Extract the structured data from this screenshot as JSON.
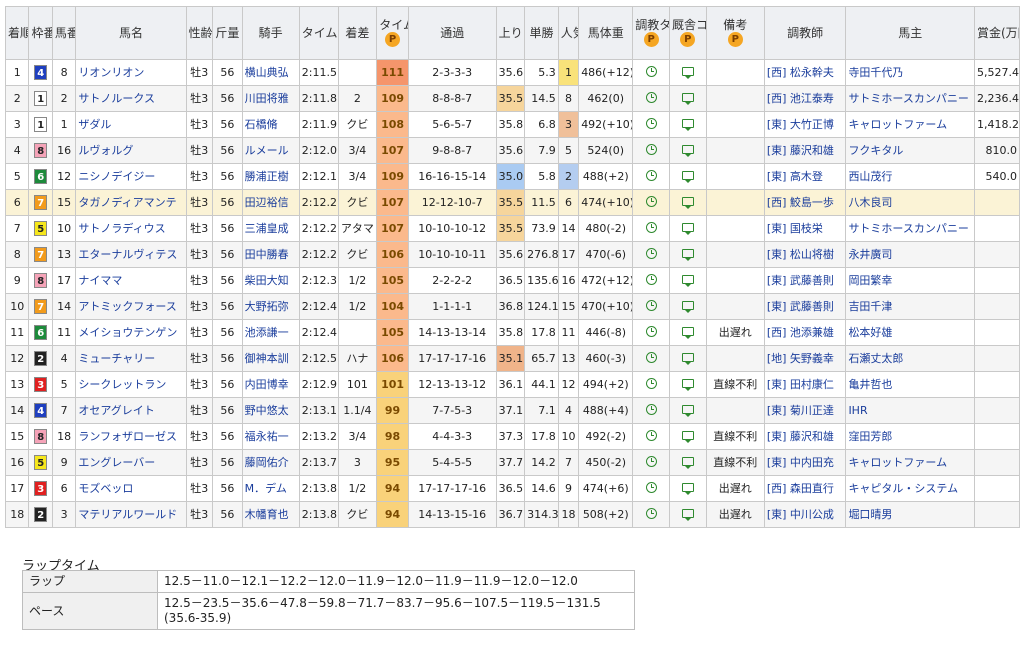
{
  "headers": {
    "rank": "着順",
    "waku": "枠番",
    "num": "馬番",
    "horse": "馬名",
    "sexage": "性齢",
    "weight": "斤量",
    "jockey": "騎手",
    "time": "タイム",
    "margin": "着差",
    "index": "タイム指数",
    "passing": "通過",
    "last3f": "上り",
    "odds": "単勝",
    "pop": "人気",
    "body": "馬体重",
    "train_time": "調教タイム",
    "stable_comment": "厩舎コメント",
    "notes": "備考",
    "trainer": "調教師",
    "owner": "馬主",
    "prize": "賞金(万円)",
    "p_label": "P"
  },
  "colors": {
    "waku": {
      "1": "#ffffff",
      "2": "#222222",
      "3": "#e02020",
      "4": "#1f3fbf",
      "5": "#f6e71c",
      "6": "#1d8a3b",
      "7": "#f29b1c",
      "8": "#f5a3b8"
    },
    "index_high": "#f5956b",
    "index_mid": "#fbb98c",
    "index_low": "#f9d27a",
    "last3f_1": "#aacbf2",
    "last3f_2": "#f0b48a",
    "last3f_3": "#f6d59c",
    "pop_1": "#f9e27a",
    "pop_2": "#b4cdf0",
    "pop_3": "#f0c09a"
  },
  "rows": [
    {
      "rank": "1",
      "waku": "4",
      "num": "8",
      "horse": "リオンリオン",
      "sexage": "牡3",
      "weight": "56",
      "jockey": "横山典弘",
      "time": "2:11.5",
      "margin": "",
      "index": "111",
      "passing": "2-3-3-3",
      "last3f": "35.6",
      "odds": "5.3",
      "pop": "1",
      "body": "486(+12)",
      "notes": "",
      "trainer": "[西] 松永幹夫",
      "owner": "寺田千代乃",
      "prize": "5,527.4"
    },
    {
      "rank": "2",
      "waku": "1",
      "num": "2",
      "horse": "サトノルークス",
      "sexage": "牡3",
      "weight": "56",
      "jockey": "川田将雅",
      "time": "2:11.8",
      "margin": "2",
      "index": "109",
      "passing": "8-8-8-7",
      "last3f": "35.5",
      "odds": "14.5",
      "pop": "8",
      "body": "462(0)",
      "notes": "",
      "trainer": "[西] 池江泰寿",
      "owner": "サトミホースカンパニー",
      "prize": "2,236.4"
    },
    {
      "rank": "3",
      "waku": "1",
      "num": "1",
      "horse": "ザダル",
      "sexage": "牡3",
      "weight": "56",
      "jockey": "石橋脩",
      "time": "2:11.9",
      "margin": "クビ",
      "index": "108",
      "passing": "5-6-5-7",
      "last3f": "35.8",
      "odds": "6.8",
      "pop": "3",
      "body": "492(+10)",
      "notes": "",
      "trainer": "[東] 大竹正博",
      "owner": "キャロットファーム",
      "prize": "1,418.2"
    },
    {
      "rank": "4",
      "waku": "8",
      "num": "16",
      "horse": "ルヴォルグ",
      "sexage": "牡3",
      "weight": "56",
      "jockey": "ルメール",
      "time": "2:12.0",
      "margin": "3/4",
      "index": "107",
      "passing": "9-8-8-7",
      "last3f": "35.6",
      "odds": "7.9",
      "pop": "5",
      "body": "524(0)",
      "notes": "",
      "trainer": "[東] 藤沢和雄",
      "owner": "フクキタル",
      "prize": "810.0"
    },
    {
      "rank": "5",
      "waku": "6",
      "num": "12",
      "horse": "ニシノデイジー",
      "sexage": "牡3",
      "weight": "56",
      "jockey": "勝浦正樹",
      "time": "2:12.1",
      "margin": "3/4",
      "index": "109",
      "passing": "16-16-15-14",
      "last3f": "35.0",
      "odds": "5.8",
      "pop": "2",
      "body": "488(+2)",
      "notes": "",
      "trainer": "[東] 高木登",
      "owner": "西山茂行",
      "prize": "540.0"
    },
    {
      "rank": "6",
      "waku": "7",
      "num": "15",
      "horse": "タガノディアマンテ",
      "sexage": "牡3",
      "weight": "56",
      "jockey": "田辺裕信",
      "time": "2:12.2",
      "margin": "クビ",
      "index": "107",
      "passing": "12-12-10-7",
      "last3f": "35.5",
      "odds": "11.5",
      "pop": "6",
      "body": "474(+10)",
      "notes": "",
      "trainer": "[西] 鮫島一歩",
      "owner": "八木良司",
      "prize": ""
    },
    {
      "rank": "7",
      "waku": "5",
      "num": "10",
      "horse": "サトノラディウス",
      "sexage": "牡3",
      "weight": "56",
      "jockey": "三浦皇成",
      "time": "2:12.2",
      "margin": "アタマ",
      "index": "107",
      "passing": "10-10-10-12",
      "last3f": "35.5",
      "odds": "73.9",
      "pop": "14",
      "body": "480(-2)",
      "notes": "",
      "trainer": "[東] 国枝栄",
      "owner": "サトミホースカンパニー",
      "prize": ""
    },
    {
      "rank": "8",
      "waku": "7",
      "num": "13",
      "horse": "エターナルヴィテス",
      "sexage": "牡3",
      "weight": "56",
      "jockey": "田中勝春",
      "time": "2:12.2",
      "margin": "クビ",
      "index": "106",
      "passing": "10-10-10-11",
      "last3f": "35.6",
      "odds": "276.8",
      "pop": "17",
      "body": "470(-6)",
      "notes": "",
      "trainer": "[東] 松山将樹",
      "owner": "永井廣司",
      "prize": ""
    },
    {
      "rank": "9",
      "waku": "8",
      "num": "17",
      "horse": "ナイママ",
      "sexage": "牡3",
      "weight": "56",
      "jockey": "柴田大知",
      "time": "2:12.3",
      "margin": "1/2",
      "index": "105",
      "passing": "2-2-2-2",
      "last3f": "36.5",
      "odds": "135.6",
      "pop": "16",
      "body": "472(+12)",
      "notes": "",
      "trainer": "[東] 武藤善則",
      "owner": "岡田繁幸",
      "prize": ""
    },
    {
      "rank": "10",
      "waku": "7",
      "num": "14",
      "horse": "アトミックフォース",
      "sexage": "牡3",
      "weight": "56",
      "jockey": "大野拓弥",
      "time": "2:12.4",
      "margin": "1/2",
      "index": "104",
      "passing": "1-1-1-1",
      "last3f": "36.8",
      "odds": "124.1",
      "pop": "15",
      "body": "470(+10)",
      "notes": "",
      "trainer": "[東] 武藤善則",
      "owner": "吉田千津",
      "prize": ""
    },
    {
      "rank": "11",
      "waku": "6",
      "num": "11",
      "horse": "メイショウテンゲン",
      "sexage": "牡3",
      "weight": "56",
      "jockey": "池添謙一",
      "time": "2:12.4",
      "margin": "",
      "index": "105",
      "passing": "14-13-13-14",
      "last3f": "35.8",
      "odds": "17.8",
      "pop": "11",
      "body": "446(-8)",
      "notes": "出遅れ",
      "trainer": "[西] 池添兼雄",
      "owner": "松本好雄",
      "prize": ""
    },
    {
      "rank": "12",
      "waku": "2",
      "num": "4",
      "horse": "ミューチャリー",
      "sexage": "牡3",
      "weight": "56",
      "jockey": "御神本訓",
      "time": "2:12.5",
      "margin": "ハナ",
      "index": "106",
      "passing": "17-17-17-16",
      "last3f": "35.1",
      "odds": "65.7",
      "pop": "13",
      "body": "460(-3)",
      "notes": "",
      "trainer": "[地] 矢野義幸",
      "owner": "石瀬丈太郎",
      "prize": ""
    },
    {
      "rank": "13",
      "waku": "3",
      "num": "5",
      "horse": "シークレットラン",
      "sexage": "牡3",
      "weight": "56",
      "jockey": "内田博幸",
      "time": "2:12.9",
      "margin": "101",
      "index": "101",
      "passing": "12-13-13-12",
      "last3f": "36.1",
      "odds": "44.1",
      "pop": "12",
      "body": "494(+2)",
      "notes": "直線不利",
      "trainer": "[東] 田村康仁",
      "owner": "亀井哲也",
      "prize": ""
    },
    {
      "rank": "14",
      "waku": "4",
      "num": "7",
      "horse": "オセアグレイト",
      "sexage": "牡3",
      "weight": "56",
      "jockey": "野中悠太",
      "time": "2:13.1",
      "margin": "1.1/4",
      "index": "99",
      "passing": "7-7-5-3",
      "last3f": "37.1",
      "odds": "7.1",
      "pop": "4",
      "body": "488(+4)",
      "notes": "",
      "trainer": "[東] 菊川正達",
      "owner": "IHR",
      "prize": ""
    },
    {
      "rank": "15",
      "waku": "8",
      "num": "18",
      "horse": "ランフォザローゼス",
      "sexage": "牡3",
      "weight": "56",
      "jockey": "福永祐一",
      "time": "2:13.2",
      "margin": "3/4",
      "index": "98",
      "passing": "4-4-3-3",
      "last3f": "37.3",
      "odds": "17.8",
      "pop": "10",
      "body": "492(-2)",
      "notes": "直線不利",
      "trainer": "[東] 藤沢和雄",
      "owner": "窪田芳郎",
      "prize": ""
    },
    {
      "rank": "16",
      "waku": "5",
      "num": "9",
      "horse": "エングレーバー",
      "sexage": "牡3",
      "weight": "56",
      "jockey": "藤岡佑介",
      "time": "2:13.7",
      "margin": "3",
      "index": "95",
      "passing": "5-4-5-5",
      "last3f": "37.7",
      "odds": "14.2",
      "pop": "7",
      "body": "450(-2)",
      "notes": "直線不利",
      "trainer": "[東] 中内田充",
      "owner": "キャロットファーム",
      "prize": ""
    },
    {
      "rank": "17",
      "waku": "3",
      "num": "6",
      "horse": "モズベッロ",
      "sexage": "牡3",
      "weight": "56",
      "jockey": "M．デム",
      "time": "2:13.8",
      "margin": "1/2",
      "index": "94",
      "passing": "17-17-17-16",
      "last3f": "36.5",
      "odds": "14.6",
      "pop": "9",
      "body": "474(+6)",
      "notes": "出遅れ",
      "trainer": "[西] 森田直行",
      "owner": "キャピタル・システム",
      "prize": ""
    },
    {
      "rank": "18",
      "waku": "2",
      "num": "3",
      "horse": "マテリアルワールド",
      "sexage": "牡3",
      "weight": "56",
      "jockey": "木幡育也",
      "time": "2:13.8",
      "margin": "クビ",
      "index": "94",
      "passing": "14-13-15-16",
      "last3f": "36.7",
      "odds": "314.3",
      "pop": "18",
      "body": "508(+2)",
      "notes": "出遅れ",
      "trainer": "[東] 中川公成",
      "owner": "堀口晴男",
      "prize": ""
    }
  ],
  "laps": {
    "title": "ラップタイム",
    "lap_label": "ラップ",
    "lap_value": "12.5－11.0－12.1－12.2－12.0－11.9－12.0－11.9－11.9－12.0－12.0",
    "pace_label": "ペース",
    "pace_value": "12.5－23.5－35.6－47.8－59.8－71.7－83.7－95.6－107.5－119.5－131.5 (35.6-35.9)"
  }
}
